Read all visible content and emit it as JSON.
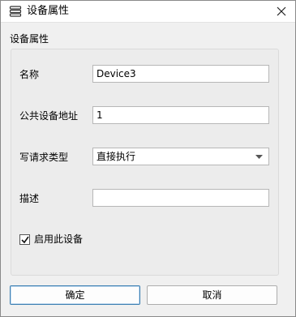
{
  "window": {
    "title": "设备属性",
    "title_icon": "list-icon",
    "close_icon": "close-icon"
  },
  "section": {
    "title": "设备属性"
  },
  "fields": {
    "name": {
      "label": "名称",
      "value": "Device3"
    },
    "address": {
      "label": "公共设备地址",
      "value": "1"
    },
    "write_type": {
      "label": "写请求类型",
      "value": "直接执行"
    },
    "description": {
      "label": "描述",
      "value": ""
    }
  },
  "enable": {
    "label": "启用此设备",
    "checked": true
  },
  "buttons": {
    "ok": "确定",
    "cancel": "取消"
  },
  "colors": {
    "primary_border": "#3c7fb1",
    "background": "#f0f0f0"
  }
}
